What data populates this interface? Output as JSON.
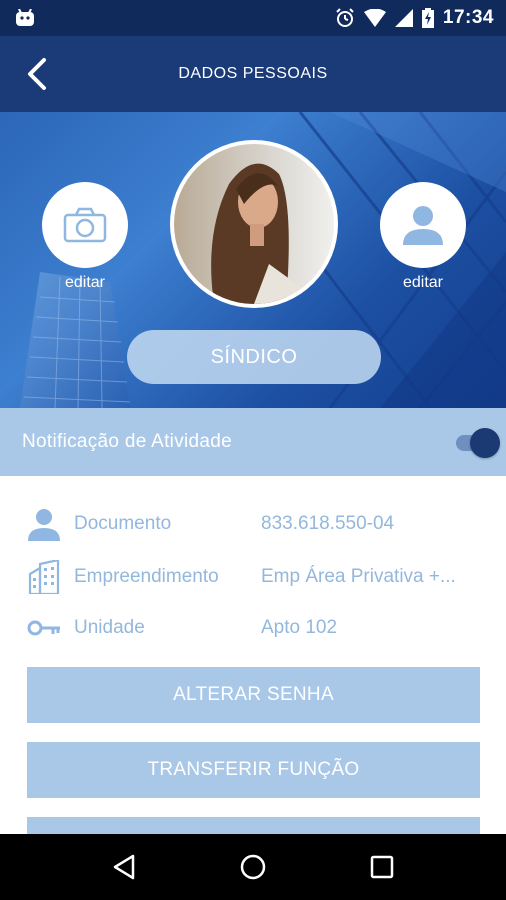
{
  "status_bar": {
    "time": "17:34"
  },
  "header": {
    "title": "DADOS PESSOAIS"
  },
  "profile": {
    "left_edit_label": "editar",
    "right_edit_label": "editar",
    "role": "SÍNDICO"
  },
  "notification": {
    "label": "Notificação de Atividade",
    "enabled": true
  },
  "info": [
    {
      "icon": "person-icon",
      "key": "Documento",
      "value": "833.618.550-04"
    },
    {
      "icon": "building-icon",
      "key": "Empreendimento",
      "value": "Emp Área Privativa +..."
    },
    {
      "icon": "key-icon",
      "key": "Unidade",
      "value": "Apto 102"
    }
  ],
  "actions": [
    {
      "label": "ALTERAR SENHA"
    },
    {
      "label": "TRANSFERIR FUNÇÃO"
    },
    {
      "label": ""
    }
  ],
  "colors": {
    "primary": "#1a3a78",
    "light_blue": "#a9c8e8",
    "text_blue": "#93b7dd"
  }
}
